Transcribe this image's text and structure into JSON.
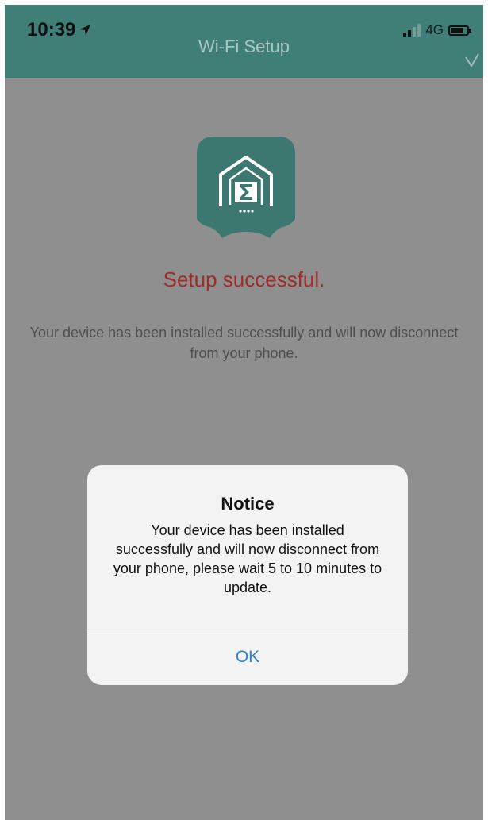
{
  "status_bar": {
    "time": "10:39",
    "network": "4G"
  },
  "nav": {
    "title": "Wi-Fi Setup"
  },
  "content": {
    "heading": "Setup successful.",
    "description": "Your device has been installed successfully and will now disconnect from your phone."
  },
  "dialog": {
    "title": "Notice",
    "message": "Your device has been installed successfully and will now disconnect from your phone, please wait 5 to 10 minutes to update.",
    "ok_label": "OK"
  },
  "colors": {
    "header_teal": "#3f7f78",
    "overlay_gray": "#8f8f8f",
    "heading_red": "#a12b27",
    "link_blue": "#2f7fd4"
  }
}
